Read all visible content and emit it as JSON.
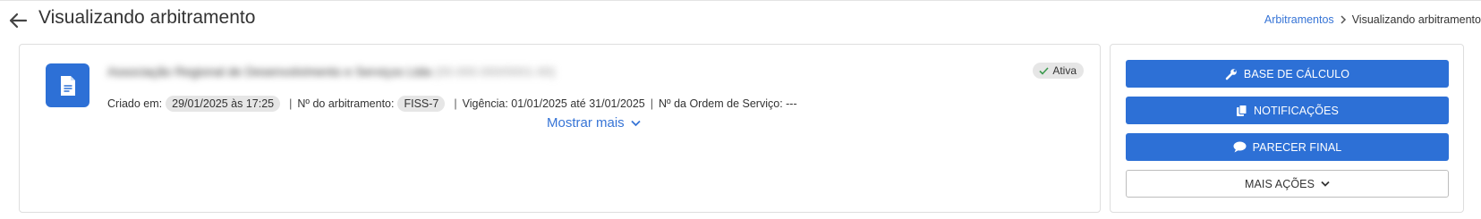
{
  "header": {
    "title": "Visualizando arbitramento",
    "back_icon": "arrow-left-icon"
  },
  "breadcrumb": {
    "parent": "Arbitramentos",
    "current": "Visualizando arbitramento"
  },
  "record": {
    "name": "Associação Regional de Desenvolvimento e Serviços Ltda",
    "name_suffix": "(00.000.000/0001-00)",
    "status": "Ativa",
    "created_label": "Criado em:",
    "created_value": "29/01/2025 às 17:25",
    "number_label": "Nº do arbitramento:",
    "number_value": "FISS-7",
    "validity_text": "Vigência: 01/01/2025 até 31/01/2025",
    "service_order_text": "Nº da Ordem de Serviço: ---",
    "separator": "|",
    "show_more": "Mostrar mais"
  },
  "actions": {
    "base_calculo": "BASE DE CÁLCULO",
    "notificacoes": "NOTIFICAÇÕES",
    "parecer_final": "PARECER FINAL",
    "mais_acoes": "MAIS AÇÕES"
  },
  "colors": {
    "primary": "#2d70d6",
    "link": "#3674d6",
    "status_check": "#3c9a4f"
  }
}
